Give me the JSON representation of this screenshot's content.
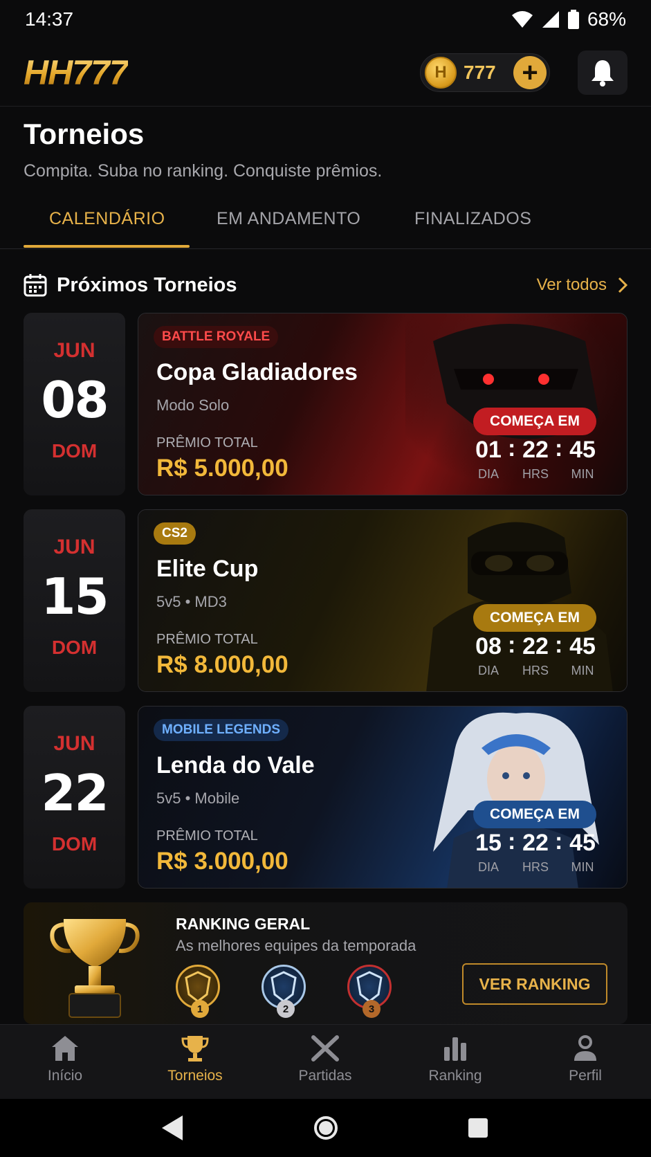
{
  "status_bar": {
    "time": "14:37",
    "battery": "68%"
  },
  "header": {
    "logo": "HH777",
    "coin_letter": "H",
    "coins": "777",
    "plus": "+"
  },
  "page": {
    "title": "Torneios",
    "subtitle": "Compita. Suba no ranking. Conquiste prêmios."
  },
  "tabs": [
    {
      "label": "CALENDÁRIO",
      "active": true
    },
    {
      "label": "EM ANDAMENTO",
      "active": false
    },
    {
      "label": "FINALIZADOS",
      "active": false
    }
  ],
  "section": {
    "title": "Próximos Torneios",
    "see_all": "Ver todos"
  },
  "tournaments": [
    {
      "month": "JUN",
      "day": "08",
      "weekday": "DOM",
      "tag": "BATTLE ROYALE",
      "name": "Copa Gladiadores",
      "mode": "Modo Solo",
      "prize_label": "PRÊMIO TOTAL",
      "prize": "R$ 5.000,00",
      "starts_label": "COMEÇA EM",
      "countdown": {
        "d": "01",
        "h": "22",
        "m": "45",
        "d_label": "DIA",
        "h_label": "HRS",
        "m_label": "MIN"
      },
      "theme": "#c22a2a"
    },
    {
      "month": "JUN",
      "day": "15",
      "weekday": "DOM",
      "tag": "CS2",
      "name": "Elite Cup",
      "mode": "5v5 • MD3",
      "prize_label": "PRÊMIO TOTAL",
      "prize": "R$ 8.000,00",
      "starts_label": "COMEÇA EM",
      "countdown": {
        "d": "08",
        "h": "22",
        "m": "45",
        "d_label": "DIA",
        "h_label": "HRS",
        "m_label": "MIN"
      },
      "theme": "#a87a10"
    },
    {
      "month": "JUN",
      "day": "22",
      "weekday": "DOM",
      "tag": "MOBILE LEGENDS",
      "name": "Lenda do Vale",
      "mode": "5v5 • Mobile",
      "prize_label": "PRÊMIO TOTAL",
      "prize": "R$ 3.000,00",
      "starts_label": "COMEÇA EM",
      "countdown": {
        "d": "15",
        "h": "22",
        "m": "45",
        "d_label": "DIA",
        "h_label": "HRS",
        "m_label": "MIN"
      },
      "theme": "#1f4f8f"
    }
  ],
  "ranking": {
    "title": "RANKING GERAL",
    "subtitle": "As melhores equipes da temporada",
    "positions": [
      "1",
      "2",
      "3"
    ],
    "button": "VER RANKING"
  },
  "bottom_nav": [
    {
      "label": "Início",
      "icon": "home-icon",
      "active": false
    },
    {
      "label": "Torneios",
      "icon": "trophy-icon",
      "active": true
    },
    {
      "label": "Partidas",
      "icon": "crossed-swords-icon",
      "active": false
    },
    {
      "label": "Ranking",
      "icon": "bar-chart-icon",
      "active": false
    },
    {
      "label": "Perfil",
      "icon": "person-icon",
      "active": false
    }
  ],
  "colors": {
    "accent": "#e1a93a",
    "red": "#d43030",
    "background": "#0b0b0c"
  }
}
